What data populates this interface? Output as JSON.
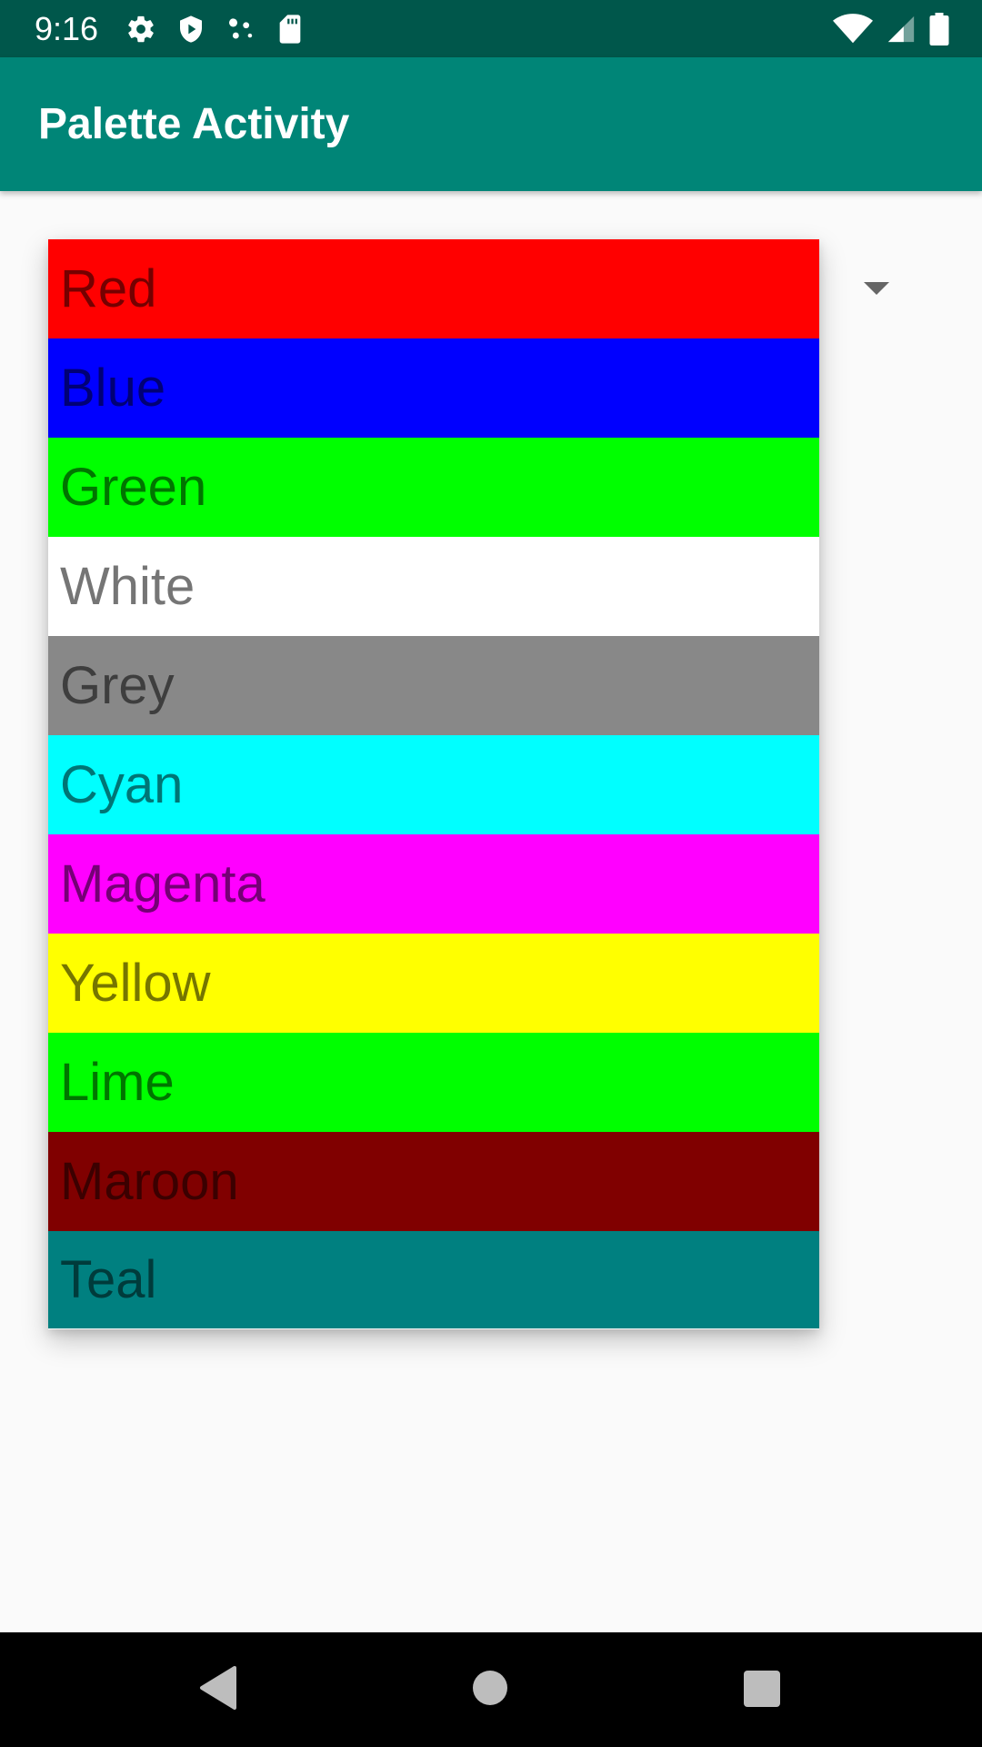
{
  "status_bar": {
    "time": "9:16",
    "left_icons": [
      "gear-icon",
      "shield-play-icon",
      "dots-icon",
      "sd-card-icon"
    ],
    "right_icons": [
      "wifi-icon",
      "signal-icon",
      "battery-icon"
    ]
  },
  "app_bar": {
    "title": "Palette Activity",
    "color": "#008577"
  },
  "dropdown": {
    "items": [
      {
        "label": "Red",
        "color": "#ff0000"
      },
      {
        "label": "Blue",
        "color": "#0000ff"
      },
      {
        "label": "Green",
        "color": "#00ff00"
      },
      {
        "label": "White",
        "color": "#ffffff"
      },
      {
        "label": "Grey",
        "color": "#888888"
      },
      {
        "label": "Cyan",
        "color": "#00ffff"
      },
      {
        "label": "Magenta",
        "color": "#ff00ff"
      },
      {
        "label": "Yellow",
        "color": "#ffff00"
      },
      {
        "label": "Lime",
        "color": "#00ff00"
      },
      {
        "label": "Maroon",
        "color": "#800000"
      },
      {
        "label": "Teal",
        "color": "#008080"
      }
    ]
  },
  "nav_bar": {
    "icons": [
      "back-icon",
      "home-icon",
      "recents-icon"
    ]
  }
}
